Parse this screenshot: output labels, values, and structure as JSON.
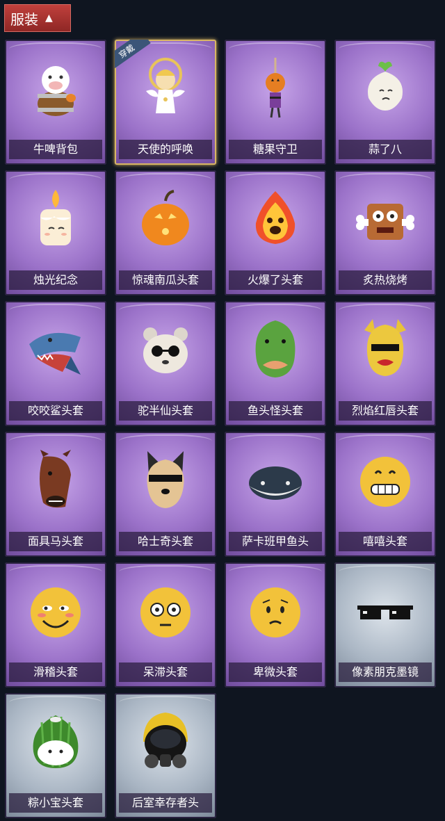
{
  "header": {
    "title": "服装",
    "toggle_icon": "chevron-up-icon"
  },
  "items": [
    {
      "label": "牛啤背包",
      "icon": "cow-beer-icon",
      "bg": "purple"
    },
    {
      "label": "天使的呼唤",
      "icon": "angel-icon",
      "bg": "purple",
      "equipped": true,
      "tag": "穿戴"
    },
    {
      "label": "糖果守卫",
      "icon": "pumpkin-doll-icon",
      "bg": "purple"
    },
    {
      "label": "蒜了八",
      "icon": "garlic-icon",
      "bg": "purple"
    },
    {
      "label": "烛光纪念",
      "icon": "candle-icon",
      "bg": "purple"
    },
    {
      "label": "惊魂南瓜头套",
      "icon": "pumpkin-head-icon",
      "bg": "purple"
    },
    {
      "label": "火爆了头套",
      "icon": "fire-head-icon",
      "bg": "purple"
    },
    {
      "label": "炙热烧烤",
      "icon": "bbq-head-icon",
      "bg": "purple"
    },
    {
      "label": "咬咬鲨头套",
      "icon": "shark-head-icon",
      "bg": "purple"
    },
    {
      "label": "驼半仙头套",
      "icon": "bear-glasses-icon",
      "bg": "purple"
    },
    {
      "label": "鱼头怪头套",
      "icon": "fish-monster-icon",
      "bg": "purple"
    },
    {
      "label": "烈焰红唇头套",
      "icon": "red-lips-mask-icon",
      "bg": "purple"
    },
    {
      "label": "面具马头套",
      "icon": "horse-mask-icon",
      "bg": "purple"
    },
    {
      "label": "哈士奇头套",
      "icon": "husky-head-icon",
      "bg": "purple"
    },
    {
      "label": "萨卡班甲鱼头",
      "icon": "fish-head-icon",
      "bg": "purple"
    },
    {
      "label": "嘻嘻头套",
      "icon": "grin-emoji-icon",
      "bg": "purple"
    },
    {
      "label": "滑稽头套",
      "icon": "funny-emoji-icon",
      "bg": "purple"
    },
    {
      "label": "呆滞头套",
      "icon": "dazed-emoji-icon",
      "bg": "purple"
    },
    {
      "label": "卑微头套",
      "icon": "humble-emoji-icon",
      "bg": "purple"
    },
    {
      "label": "像素朋克墨镜",
      "icon": "pixel-sunglasses-icon",
      "bg": "gray"
    },
    {
      "label": "粽小宝头套",
      "icon": "zongzi-head-icon",
      "bg": "gray"
    },
    {
      "label": "后室幸存者头",
      "icon": "gas-mask-icon",
      "bg": "gray"
    }
  ]
}
